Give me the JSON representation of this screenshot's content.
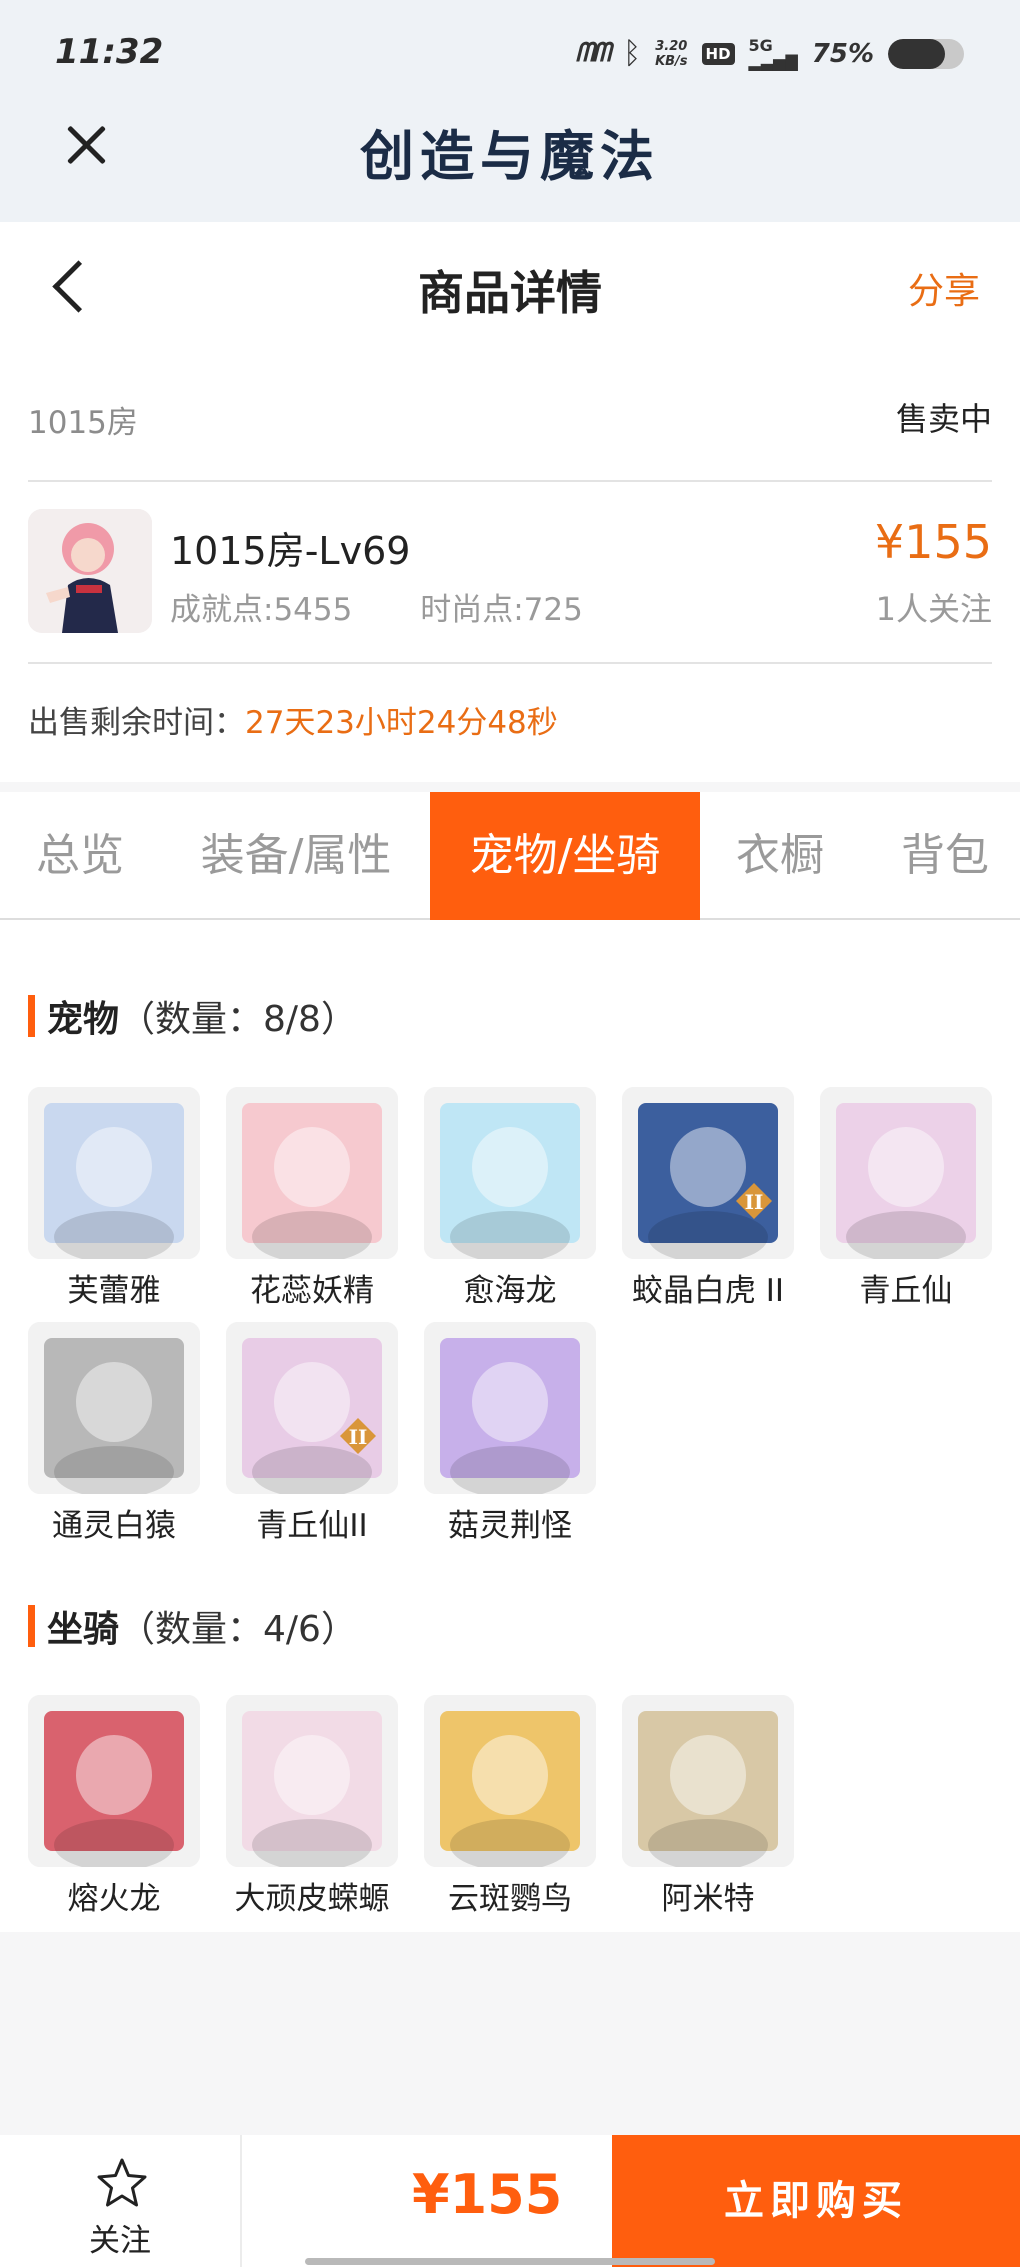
{
  "status_bar": {
    "time": "11:32",
    "signal_text": "ᗰᗰ",
    "bluetooth_icon": "bluetooth-icon",
    "speed_value": "3.20",
    "speed_unit": "KB/s",
    "hd_label": "HD",
    "network_label": "5G",
    "battery_percent_label": "75%",
    "battery_level": 0.75
  },
  "app_header": {
    "title": "创造与魔法",
    "close_icon": "close-icon"
  },
  "page_header": {
    "title": "商品详情",
    "share_label": "分享",
    "back_icon": "chevron-left-icon"
  },
  "item": {
    "room": "1015房",
    "status": "售卖中",
    "character_name": "1015房-Lv69",
    "achievement": "成就点:5455",
    "fashion": "时尚点:725",
    "price": "¥155",
    "followers": "1人关注",
    "remaining_label": "出售剩余时间：",
    "remaining_value": "27天23小时24分48秒"
  },
  "tabs": [
    {
      "label": "总览",
      "active": false
    },
    {
      "label": "装备/属性",
      "active": false
    },
    {
      "label": "宠物/坐骑",
      "active": true
    },
    {
      "label": "衣橱",
      "active": false
    },
    {
      "label": "背包",
      "active": false
    }
  ],
  "pets": {
    "title": "宠物",
    "count": "（数量：8/8）",
    "items": [
      {
        "name": "芙蕾雅",
        "color": "#c9d8ef",
        "badge": false
      },
      {
        "name": "花蕊妖精",
        "color": "#f6c9cf",
        "badge": false
      },
      {
        "name": "愈海龙",
        "color": "#bfe6f5",
        "badge": false
      },
      {
        "name": "蛟晶白虎 II",
        "color": "#3c5f9e",
        "badge": true
      },
      {
        "name": "青丘仙",
        "color": "#ecd1e8",
        "badge": false
      },
      {
        "name": "通灵白猿",
        "color": "#b8b8b8",
        "badge": false
      },
      {
        "name": "青丘仙II",
        "color": "#e8cce6",
        "badge": true
      },
      {
        "name": "菇灵荆怪",
        "color": "#c7b0ea",
        "badge": false
      }
    ]
  },
  "mounts": {
    "title": "坐骑",
    "count": "（数量：4/6）",
    "items": [
      {
        "name": "熔火龙",
        "color": "#d9626e"
      },
      {
        "name": "大顽皮蝾螈",
        "color": "#f2dbe6"
      },
      {
        "name": "云斑鹦鸟",
        "color": "#eec56a"
      },
      {
        "name": "阿米特",
        "color": "#d8c8a6"
      }
    ]
  },
  "bottom_bar": {
    "follow_label": "关注",
    "follow_icon": "star-icon",
    "price": "¥155",
    "buy_label": "立即购买"
  }
}
